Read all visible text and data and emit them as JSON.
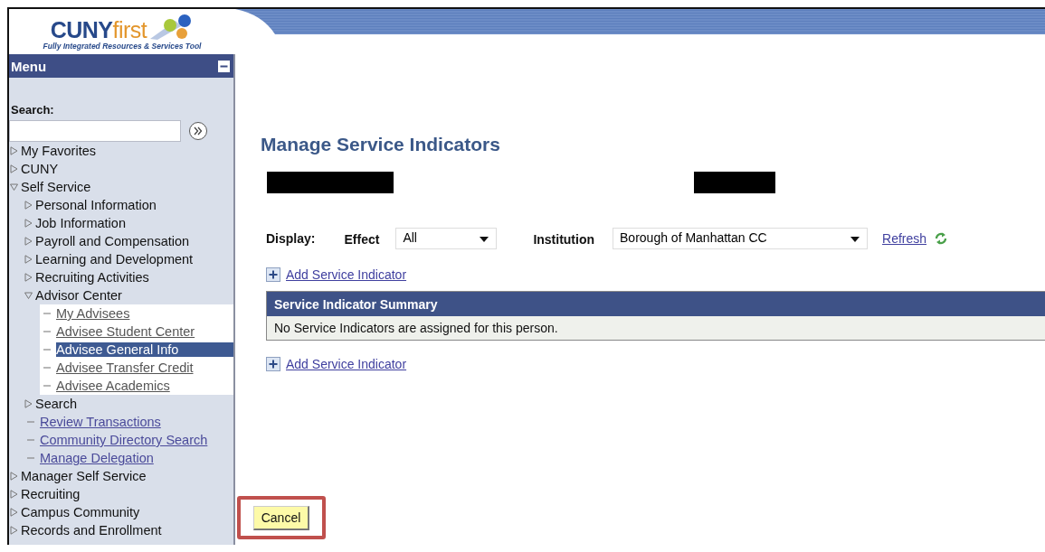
{
  "logo": {
    "title": "CUNY",
    "title_suffix": "first",
    "tagline": "Fully Integrated Resources & Services Tool"
  },
  "menu": {
    "title": "Menu",
    "search_label": "Search:",
    "items": [
      {
        "kind": "folder",
        "label": "My Favorites",
        "expanded": false
      },
      {
        "kind": "folder",
        "label": "CUNY",
        "expanded": false
      },
      {
        "kind": "folder",
        "label": "Self Service",
        "expanded": true,
        "children": [
          {
            "kind": "folder",
            "label": "Personal Information",
            "expanded": false
          },
          {
            "kind": "folder",
            "label": "Job Information",
            "expanded": false
          },
          {
            "kind": "folder",
            "label": "Payroll and Compensation",
            "expanded": false
          },
          {
            "kind": "folder",
            "label": "Learning and Development",
            "expanded": false
          },
          {
            "kind": "folder",
            "label": "Recruiting Activities",
            "expanded": false
          },
          {
            "kind": "folder",
            "label": "Advisor Center",
            "expanded": true,
            "children": [
              {
                "kind": "link",
                "label": "My Advisees",
                "selected": false
              },
              {
                "kind": "link",
                "label": "Advisee Student Center",
                "selected": false
              },
              {
                "kind": "link",
                "label": "Advisee General Info",
                "selected": true
              },
              {
                "kind": "link",
                "label": "Advisee Transfer Credit",
                "selected": false
              },
              {
                "kind": "link",
                "label": "Advisee Academics",
                "selected": false
              }
            ]
          },
          {
            "kind": "folder",
            "label": "Search",
            "expanded": false
          },
          {
            "kind": "link",
            "label": "Review Transactions",
            "selected": false
          },
          {
            "kind": "link",
            "label": "Community Directory Search",
            "selected": false
          },
          {
            "kind": "link",
            "label": "Manage Delegation",
            "selected": false
          }
        ]
      },
      {
        "kind": "folder",
        "label": "Manager Self Service",
        "expanded": false
      },
      {
        "kind": "folder",
        "label": "Recruiting",
        "expanded": false
      },
      {
        "kind": "folder",
        "label": "Campus Community",
        "expanded": false
      },
      {
        "kind": "folder",
        "label": "Records and Enrollment",
        "expanded": false
      }
    ]
  },
  "page": {
    "title": "Manage Service Indicators",
    "display_label": "Display:",
    "filters": [
      {
        "label": "Effect",
        "value": "All"
      },
      {
        "label": "Institution",
        "value": "Borough of Manhattan CC"
      }
    ],
    "refresh": "Refresh",
    "add_link_top": "Add Service Indicator",
    "summary": {
      "title": "Service Indicator Summary",
      "message": "No Service Indicators are assigned for this person."
    },
    "add_link_bottom": "Add Service Indicator",
    "cancel": "Cancel"
  }
}
